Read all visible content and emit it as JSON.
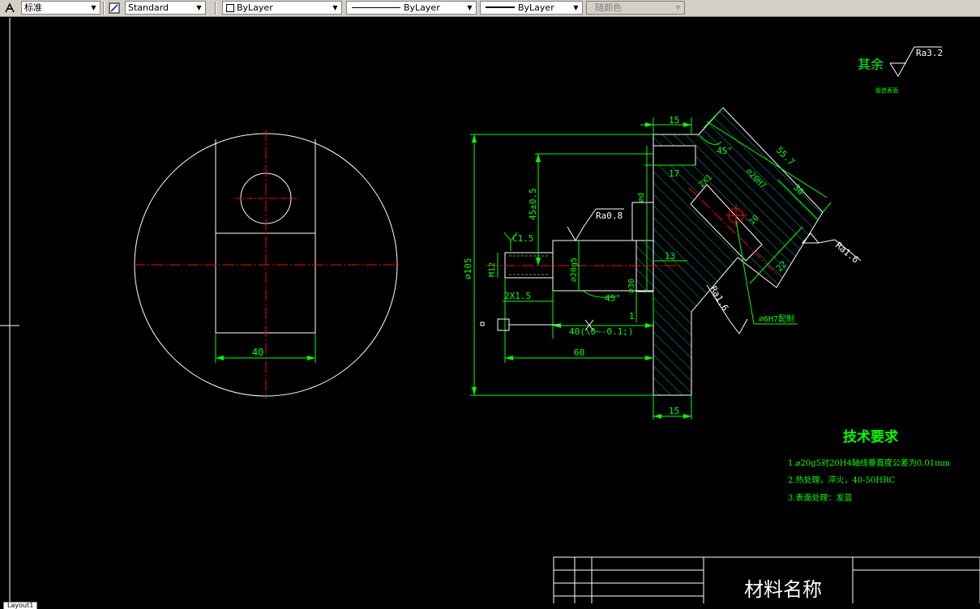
{
  "toolbar": {
    "text_style": "标准",
    "dim_style": "Standard",
    "layer": "ByLayer",
    "linetype": "ByLayer",
    "lineweight": "ByLayer",
    "color": "随颜色"
  },
  "drawing": {
    "dims": {
      "width_40": "40",
      "top_15": "15",
      "bottom_15": "15",
      "len_60": "60",
      "len_40": "40(\\0~-0.1;)",
      "dia_105": "⌀105",
      "h_45": "45±0.5",
      "dim_17": "17",
      "dim_13": "13",
      "dim_1": "1",
      "angle_45a": "45°",
      "angle_45b": "45°",
      "diag_55": "55.7",
      "diag_30": "30",
      "diag_22": "22",
      "diag_10": "10",
      "dia_20g5": "⌀20g5",
      "dia_d": "⌀d",
      "dia_20H7": "⌀20H7",
      "dia_30": "⌀30",
      "thread": "M12",
      "chamfer_c15": "C1.5",
      "chamfer_2x15": "2X1.5",
      "chamfer_2x1": "2X1",
      "pin_note": "⌀6H7配制"
    },
    "roughness": {
      "ra08": "Ra0.8",
      "ra16a": "Ra1.6",
      "ra16b": "Ra1.6",
      "ra32": "Ra3.2",
      "rest_label": "其余",
      "rest_sub": "锻造表面"
    },
    "tech_req": {
      "title": "技术要求",
      "items": [
        "1.⌀20g5对20H4轴线垂直度公差为0.01mm",
        "2.热处理，淬火，40-50HRC",
        "3.表面处理：发蓝"
      ]
    },
    "title_block": {
      "material": "材料名称"
    }
  },
  "bottom_tab": "Layout1",
  "colors": {
    "green": "#00ff00",
    "red": "#ff0000",
    "white": "#ffffff",
    "hatch": "#00c8c8",
    "background": "#000000"
  }
}
